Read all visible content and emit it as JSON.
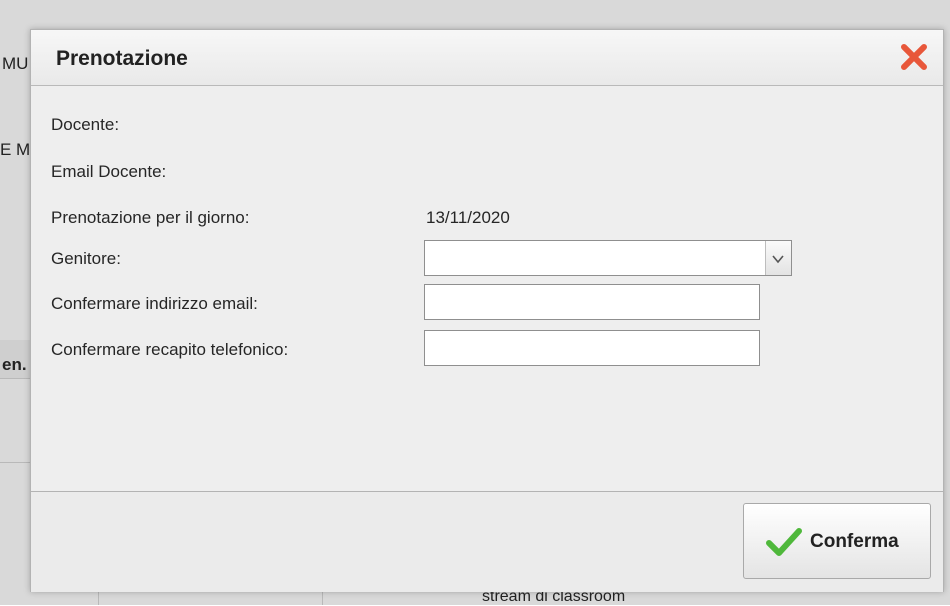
{
  "background": {
    "fragments": [
      "MU",
      "E M",
      "en.",
      "stream di classroom"
    ]
  },
  "dialog": {
    "title": "Prenotazione",
    "close_icon": "close-x-icon",
    "fields": {
      "docente_label": "Docente:",
      "email_docente_label": "Email Docente:",
      "giorno_label": "Prenotazione per il giorno:",
      "giorno_value": "13/11/2020",
      "genitore_label": "Genitore:",
      "genitore_value": "",
      "email_label": "Confermare indirizzo email:",
      "email_value": "",
      "telefono_label": "Confermare recapito telefonico:",
      "telefono_value": ""
    },
    "confirm_button": {
      "label": "Conferma",
      "icon": "checkmark-icon"
    }
  },
  "colors": {
    "close_red": "#e8573a",
    "check_green": "#4fb83b",
    "dialog_bg": "#eeeeee"
  }
}
